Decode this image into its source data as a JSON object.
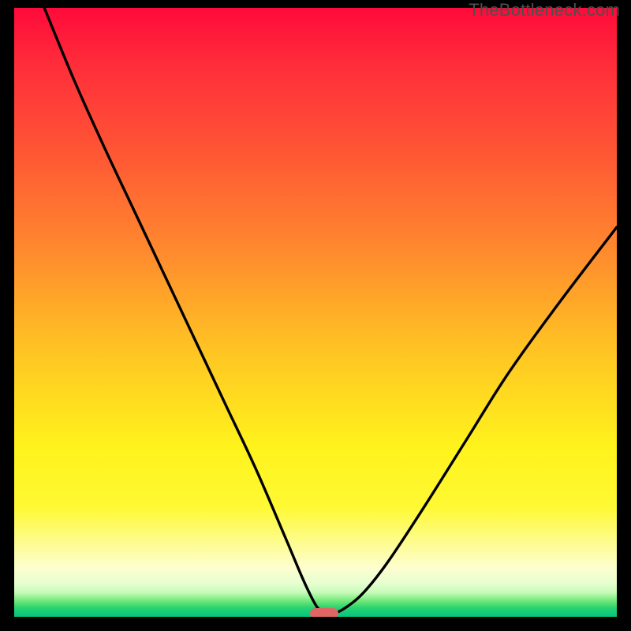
{
  "watermark": "TheBottleneck.com",
  "colors": {
    "background": "#000000",
    "curve": "#000000",
    "marker": "#e06666",
    "gradient_top": "#ff0a3a",
    "gradient_bottom": "#00c681"
  },
  "chart_data": {
    "type": "line",
    "title": "",
    "xlabel": "",
    "ylabel": "",
    "xlim": [
      0,
      100
    ],
    "ylim": [
      0,
      100
    ],
    "grid": false,
    "series": [
      {
        "name": "bottleneck-curve",
        "x": [
          5,
          10,
          15,
          20,
          25,
          30,
          35,
          40,
          45,
          48,
          50,
          51,
          52,
          53,
          55,
          58,
          62,
          68,
          75,
          82,
          90,
          100
        ],
        "values": [
          100,
          88,
          77,
          66.5,
          56,
          45.5,
          35,
          24.5,
          13,
          6,
          2,
          1,
          0.5,
          0.5,
          1.5,
          4,
          9,
          18,
          29,
          40,
          51,
          64
        ]
      }
    ],
    "marker": {
      "x": 51.5,
      "y": 0.5,
      "shape": "pill"
    },
    "notes": "Background is a vertical red→green gradient indicating bottleneck severity (top=worst, bottom=best). Curve dips to near-zero around x≈51."
  }
}
